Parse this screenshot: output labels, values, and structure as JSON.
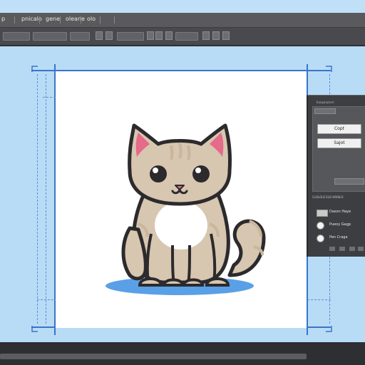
{
  "menu": {
    "items": [
      {
        "label": "p",
        "x": 0
      },
      {
        "label": "pnicalo",
        "x": 0
      },
      {
        "label": "gene",
        "x": 0
      },
      {
        "label": "oleane",
        "x": 0
      },
      {
        "label": "olo",
        "x": 0
      }
    ]
  },
  "panel": {
    "title": "Eanpaiaclorl",
    "buttons": {
      "copy": "Copt",
      "select": "Sajot"
    },
    "subhead": "CLOLOLE ELO HRHILO",
    "options": [
      {
        "label": "Dason Haye"
      },
      {
        "label": "Pueoy Gagp"
      },
      {
        "label": "Pen Crage"
      }
    ]
  },
  "colors": {
    "background": "#b8dcf6",
    "menubar": "#5a5a5c",
    "toolbar": "#494a4d",
    "panel": "#3d3e42",
    "guide": "#3a74c9",
    "cat_body": "#d7c6b0",
    "cat_outline": "#2c2a2c",
    "cat_ear_inner": "#e66a8a",
    "shadow": "#5aa0e6"
  },
  "icons": [
    "cat-illustration",
    "corner-crop-mark"
  ]
}
